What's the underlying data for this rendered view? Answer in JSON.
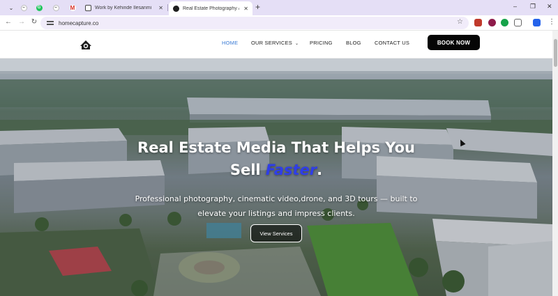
{
  "browser": {
    "tabs": [
      {
        "label": "Work by Kehinde Ilesanmi",
        "active": false
      },
      {
        "label": "Real Estate Photography & Me",
        "active": true
      }
    ],
    "url": "homecapture.co"
  },
  "site": {
    "nav": {
      "home": "HOME",
      "services": "OUR SERVICES",
      "pricing": "PRICING",
      "blog": "BLOG",
      "contact": "CONTACT US",
      "book": "BOOK NOW"
    },
    "hero": {
      "title_line1": "Real Estate Media That Helps You",
      "title_line2_prefix": "Sell",
      "title_accent": "Faster",
      "title_suffix": ".",
      "subtitle_line1": "Professional photography, cinematic video,drone, and 3D tours — built to",
      "subtitle_line2": "elevate your listings and impress clients.",
      "cta": "View Services"
    }
  },
  "colors": {
    "tabstrip": "#e5dff6",
    "nav_active": "#3a7bd5",
    "accent_text": "#2f3ee8",
    "book_button": "#050505"
  }
}
